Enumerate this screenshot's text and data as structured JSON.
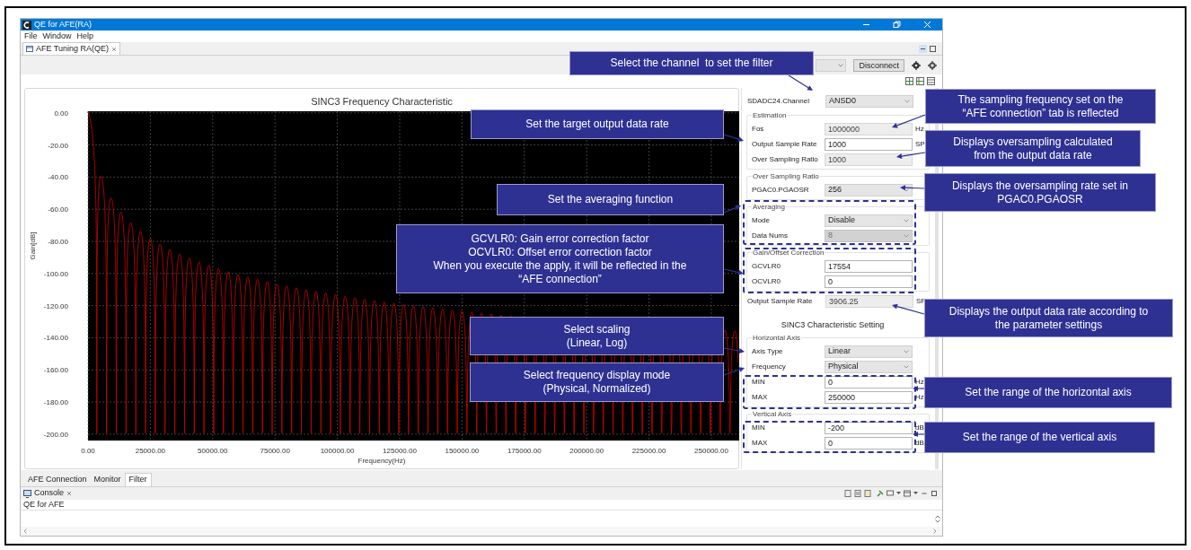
{
  "window": {
    "title": "QE for AFE(RA)",
    "menu": [
      "File",
      "Window",
      "Help"
    ],
    "view_tab": "AFE Tuning RA(QE)",
    "toolbar": {
      "button": "Disconnect"
    }
  },
  "chart": {
    "chart_data": {
      "type": "line",
      "title": "SINC3 Frequency Characteristic",
      "xlabel": "Frequency(Hz)",
      "ylabel": "Gain[dB]",
      "xlim": [
        0,
        261170
      ],
      "ylim": [
        -204,
        1
      ],
      "grid": true,
      "xticks": [
        {
          "value": 0,
          "label": "0.00"
        },
        {
          "value": 25000,
          "label": "25000.00"
        },
        {
          "value": 50000,
          "label": "50000.00"
        },
        {
          "value": 75000,
          "label": "75000.00"
        },
        {
          "value": 100000,
          "label": "100000.00"
        },
        {
          "value": 125000,
          "label": "125000.00"
        },
        {
          "value": 150000,
          "label": "150000.00"
        },
        {
          "value": 175000,
          "label": "175000.00"
        },
        {
          "value": 200000,
          "label": "200000.00"
        },
        {
          "value": 225000,
          "label": "225000.00"
        },
        {
          "value": 250000,
          "label": "250000.00"
        }
      ],
      "yticks": [
        {
          "value": 0,
          "label": "0.00"
        },
        {
          "value": -20,
          "label": "-20.00"
        },
        {
          "value": -40,
          "label": "-40.00"
        },
        {
          "value": -60,
          "label": "-60.00"
        },
        {
          "value": -80,
          "label": "-80.00"
        },
        {
          "value": -100,
          "label": "-100.00"
        },
        {
          "value": -120,
          "label": "-120.00"
        },
        {
          "value": -140,
          "label": "-140.00"
        },
        {
          "value": -160,
          "label": "-160.00"
        },
        {
          "value": -180,
          "label": "-180.00"
        },
        {
          "value": -200,
          "label": "-200.00"
        }
      ]
    }
  },
  "settings": [
    {
      "kind": "select",
      "label": "SDADC24.Channel",
      "value": "ANSD0",
      "disabled": false
    },
    {
      "kind": "group",
      "title": "Estimation",
      "rows": [
        {
          "kind": "input",
          "label": "Fos",
          "value": "1000000",
          "disabled": true,
          "unit": "Hz"
        },
        {
          "kind": "input",
          "label": "Output Sample Rate",
          "value": "1000",
          "disabled": false,
          "unit": "SP"
        },
        {
          "kind": "input",
          "label": "Over Sampling Ratio",
          "value": "1000",
          "disabled": true
        }
      ]
    },
    {
      "kind": "group",
      "title": "Over Sampling Ratio",
      "rows": [
        {
          "kind": "select",
          "label": "PGAC0.PGAOSR",
          "value": "256",
          "disabled": false
        }
      ]
    },
    {
      "kind": "group",
      "title": "Averaging",
      "rows": [
        {
          "kind": "select",
          "label": "Mode",
          "value": "Disable",
          "disabled": false
        },
        {
          "kind": "select",
          "label": "Data Nums",
          "value": "8",
          "disabled": true
        }
      ]
    },
    {
      "kind": "group",
      "title": "Gain/Offset Correction",
      "rows": [
        {
          "kind": "input",
          "label": "GCVLR0",
          "value": "17554",
          "disabled": false
        },
        {
          "kind": "input",
          "label": "OCVLR0",
          "value": "0",
          "disabled": false
        }
      ]
    },
    {
      "kind": "input",
      "label": "Output Sample Rate",
      "value": "3906.25",
      "disabled": true,
      "unit": "SP"
    },
    {
      "kind": "heading",
      "text": "SINC3 Characteristic Setting"
    },
    {
      "kind": "group",
      "title": "Horizontal Axis",
      "rows": [
        {
          "kind": "select",
          "label": "Axis Type",
          "value": "Linear",
          "disabled": false
        },
        {
          "kind": "select",
          "label": "Frequency",
          "value": "Physical",
          "disabled": false
        },
        {
          "kind": "input",
          "label": "MIN",
          "value": "0",
          "disabled": false,
          "unit": "Hz"
        },
        {
          "kind": "input",
          "label": "MAX",
          "value": "250000",
          "disabled": false,
          "unit": "Hz"
        }
      ]
    },
    {
      "kind": "group",
      "title": "Vertical Axis",
      "rows": [
        {
          "kind": "input",
          "label": "MIN",
          "value": "-200",
          "disabled": false,
          "unit": "dB"
        },
        {
          "kind": "input",
          "label": "MAX",
          "value": "0",
          "disabled": false,
          "unit": "dB"
        }
      ]
    }
  ],
  "bottom_tabs": [
    {
      "label": "AFE Connection",
      "selected": false
    },
    {
      "label": "Monitor",
      "selected": false
    },
    {
      "label": "Filter",
      "selected": true
    }
  ],
  "console": {
    "tab": "Console",
    "text": "QE for AFE"
  },
  "left_callouts": [
    {
      "lines": [
        "Select the channel  to set the filter"
      ]
    },
    {
      "lines": [
        "Set the target output data rate"
      ]
    },
    {
      "lines": [
        "Set the averaging function"
      ]
    },
    {
      "lines": [
        "GCVLR0: Gain error correction factor",
        "OCVLR0: Offset error correction factor",
        "When you execute the apply, it will be reflected in the",
        "“AFE connection”"
      ]
    },
    {
      "lines": [
        "Select scaling",
        "(Linear, Log)"
      ]
    },
    {
      "lines": [
        "Select frequency display mode",
        "(Physical, Normalized)"
      ]
    }
  ],
  "right_callouts": [
    {
      "lines": [
        "The sampling frequency set on the",
        "“AFE connection” tab is reflected"
      ]
    },
    {
      "lines": [
        "Displays oversampling calculated",
        "from the output data rate"
      ]
    },
    {
      "lines": [
        "Displays the oversampling rate set in",
        "PGAC0.PGAOSR"
      ]
    },
    {
      "lines": [
        "Displays the output data rate according to",
        "the parameter settings"
      ]
    },
    {
      "lines": [
        "Set the range of the horizontal axis"
      ]
    },
    {
      "lines": [
        "Set the range of the vertical axis"
      ]
    }
  ]
}
